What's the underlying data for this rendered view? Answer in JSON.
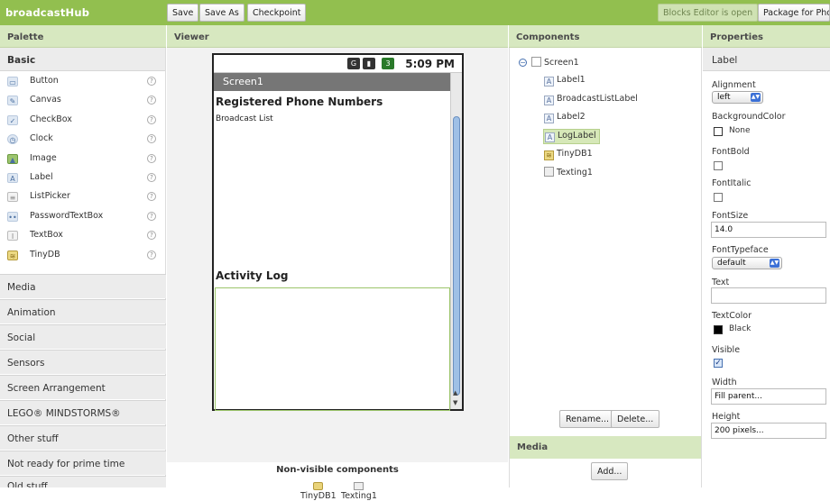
{
  "app": {
    "title": "broadcastHub"
  },
  "toolbar": {
    "save": "Save",
    "save_as": "Save As",
    "checkpoint": "Checkpoint",
    "blocks_editor": "Blocks Editor is open",
    "package": "Package for Phone"
  },
  "headers": {
    "palette": "Palette",
    "viewer": "Viewer",
    "components": "Components",
    "properties": "Properties"
  },
  "palette": {
    "basic": "Basic",
    "help": "?",
    "items": [
      {
        "label": "Button",
        "icon": "button-icon"
      },
      {
        "label": "Canvas",
        "icon": "canvas-icon"
      },
      {
        "label": "CheckBox",
        "icon": "checkbox-icon"
      },
      {
        "label": "Clock",
        "icon": "clock-icon"
      },
      {
        "label": "Image",
        "icon": "image-icon"
      },
      {
        "label": "Label",
        "icon": "label-icon"
      },
      {
        "label": "ListPicker",
        "icon": "listpicker-icon"
      },
      {
        "label": "PasswordTextBox",
        "icon": "password-textbox-icon"
      },
      {
        "label": "TextBox",
        "icon": "textbox-icon"
      },
      {
        "label": "TinyDB",
        "icon": "tinydb-icon"
      }
    ],
    "drawers": [
      "Media",
      "Animation",
      "Social",
      "Sensors",
      "Screen Arrangement",
      "LEGO® MINDSTORMS®",
      "Other stuff",
      "Not ready for prime time",
      "Old stuff"
    ]
  },
  "phone": {
    "time": "5:09 PM",
    "screen_title": "Screen1",
    "registered_title": "Registered Phone Numbers",
    "broadcast_list": "Broadcast List",
    "activity_log": "Activity Log"
  },
  "nonvisible": {
    "title": "Non-visible components",
    "items": [
      "TinyDB1",
      "Texting1"
    ]
  },
  "components": {
    "tree": [
      "Screen1",
      "Label1",
      "BroadcastListLabel",
      "Label2",
      "LogLabel",
      "TinyDB1",
      "Texting1"
    ],
    "selected": "LogLabel",
    "rename": "Rename...",
    "delete": "Delete...",
    "media": "Media",
    "add": "Add..."
  },
  "properties": {
    "type": "Label",
    "alignment_label": "Alignment",
    "alignment": "left",
    "bgcolor_label": "BackgroundColor",
    "bgcolor": "None",
    "fontbold_label": "FontBold",
    "fontbold": false,
    "fontitalic_label": "FontItalic",
    "fontitalic": false,
    "fontsize_label": "FontSize",
    "fontsize": "14.0",
    "fonttypeface_label": "FontTypeface",
    "fonttypeface": "default",
    "text_label": "Text",
    "text": "",
    "textcolor_label": "TextColor",
    "textcolor": "Black",
    "visible_label": "Visible",
    "visible": true,
    "width_label": "Width",
    "width": "Fill parent...",
    "height_label": "Height",
    "height": "200 pixels..."
  },
  "colors": {
    "accent": "#92bf4f",
    "header": "#d7e8c0"
  }
}
